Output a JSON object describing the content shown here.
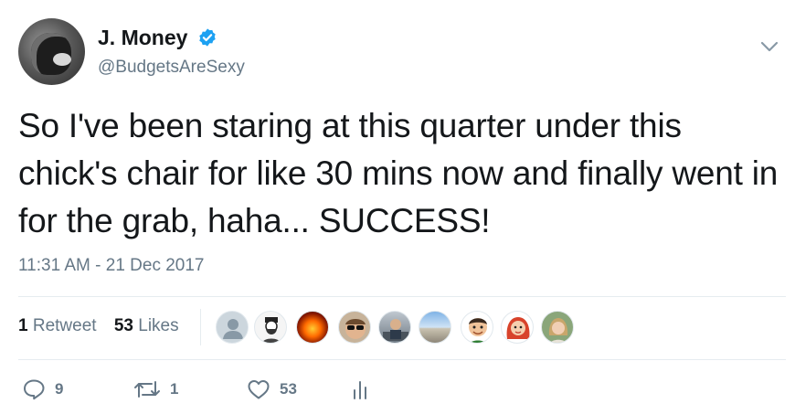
{
  "author": {
    "display_name": "J. Money",
    "handle": "@BudgetsAreSexy",
    "verified": true
  },
  "tweet": {
    "text": "So I've been staring at this quarter under this chick's chair for like 30 mins now and finally went in for the grab, haha... SUCCESS!",
    "timestamp": "11:31 AM - 21 Dec 2017"
  },
  "stats": {
    "retweets_count": "1",
    "retweets_label": "Retweet",
    "likes_count": "53",
    "likes_label": "Likes"
  },
  "liker_avatars": [
    "default-egg",
    "bearded-man-sketch",
    "fire",
    "man-sunglasses",
    "man-at-desk",
    "landscape",
    "cartoon-man",
    "red-hair-woman",
    "woman-outdoors"
  ],
  "actions": {
    "replies": "9",
    "retweets": "1",
    "likes": "53"
  },
  "colors": {
    "verified": "#1da1f2",
    "secondary_text": "#657786",
    "divider": "#e6ecf0"
  }
}
